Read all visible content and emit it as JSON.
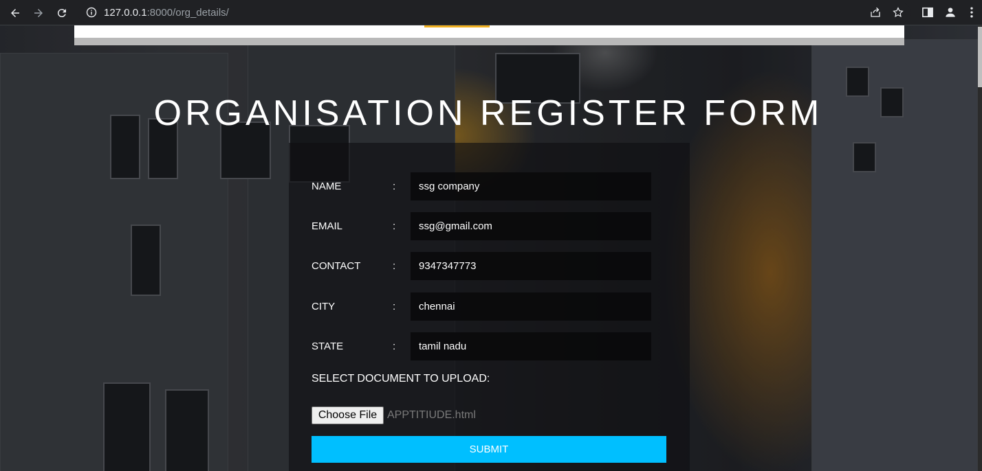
{
  "browser": {
    "url_host": "127.0.0.1",
    "url_path": ":8000/org_details/"
  },
  "page": {
    "title": "ORGANISATION REGISTER FORM",
    "fields": [
      {
        "label": "NAME",
        "value": "ssg company"
      },
      {
        "label": "EMAIL",
        "value": "ssg@gmail.com"
      },
      {
        "label": "CONTACT",
        "value": "9347347773"
      },
      {
        "label": "CITY",
        "value": "chennai"
      },
      {
        "label": "STATE",
        "value": "tamil nadu"
      }
    ],
    "colon": ":",
    "upload_label": "SELECT DOCUMENT TO UPLOAD:",
    "choose_file_label": "Choose File",
    "file_name": "APPTITIUDE.html",
    "submit_label": "SUBMIT"
  },
  "colors": {
    "submit": "#00bfff",
    "accent": "#f0b020"
  }
}
